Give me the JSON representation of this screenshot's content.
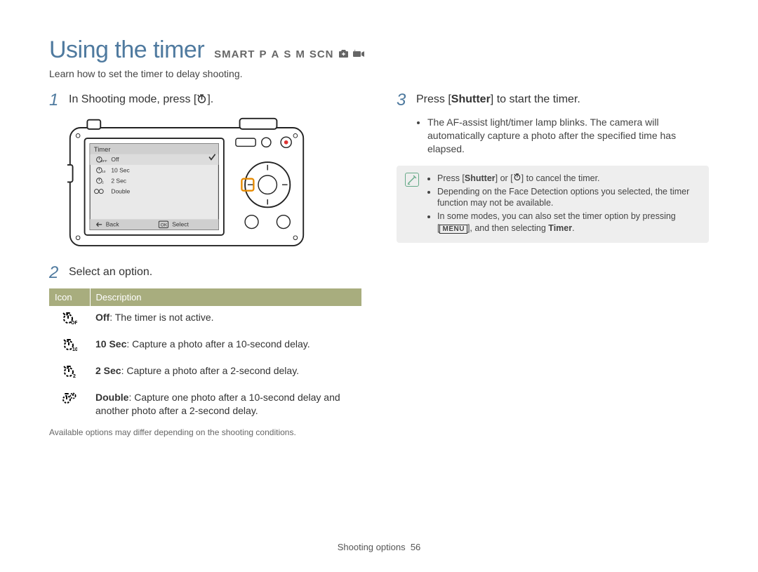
{
  "header": {
    "title": "Using the timer",
    "modes": [
      "SMART",
      "P",
      "A",
      "S",
      "M",
      "SCN"
    ],
    "subtitle": "Learn how to set the timer to delay shooting."
  },
  "left": {
    "step1": {
      "num": "1",
      "text_before": "In Shooting mode, press [",
      "text_after": "]."
    },
    "camera_menu": {
      "title": "Timer",
      "items": [
        "Off",
        "10 Sec",
        "2 Sec",
        "Double"
      ],
      "selected_index": 0,
      "back_label": "Back",
      "select_label": "Select"
    },
    "step2": {
      "num": "2",
      "text": "Select an option."
    },
    "table": {
      "head_icon": "Icon",
      "head_desc": "Description",
      "rows": [
        {
          "bold": "Off",
          "rest": ": The timer is not active."
        },
        {
          "bold": "10 Sec",
          "rest": ": Capture a photo after a 10-second delay."
        },
        {
          "bold": "2 Sec",
          "rest": ": Capture a photo after a 2-second delay."
        },
        {
          "bold": "Double",
          "rest": ": Capture one photo after a 10-second delay and another photo after a 2-second delay."
        }
      ]
    },
    "small_note": "Available options may differ depending on the shooting conditions."
  },
  "right": {
    "step3": {
      "num": "3",
      "text_before": "Press [",
      "bold": "Shutter",
      "text_after": "] to start the timer."
    },
    "bullet": "The AF-assist light/timer lamp blinks. The camera will automatically capture a photo after the specified time has elapsed.",
    "note": {
      "n1_before": "Press [",
      "n1_bold": "Shutter",
      "n1_mid": "] or [",
      "n1_after": "] to cancel the timer.",
      "n2": "Depending on the Face Detection options you selected, the timer function may not be available.",
      "n3_before": "In some modes, you can also set the timer option by pressing [",
      "n3_menu": "MENU",
      "n3_mid": "], and then selecting ",
      "n3_bold": "Timer",
      "n3_after": "."
    }
  },
  "footer": {
    "section": "Shooting options",
    "page": "56"
  }
}
